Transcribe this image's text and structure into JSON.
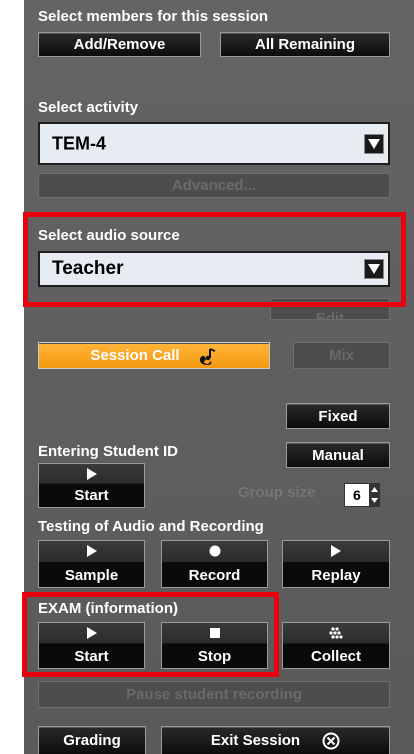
{
  "members": {
    "heading": "Select members for this session",
    "add_remove": "Add/Remove",
    "all_remaining": "All Remaining"
  },
  "activity": {
    "heading": "Select activity",
    "value": "TEM-4",
    "advanced": "Advanced..."
  },
  "audio": {
    "heading": "Select audio source",
    "value": "Teacher",
    "edit": "Edit"
  },
  "session_call": {
    "label": "Session Call",
    "mix": "Mix",
    "accent": "#f7a325"
  },
  "mode": {
    "fixed": "Fixed",
    "manual": "Manual"
  },
  "student_id": {
    "heading": "Entering Student ID",
    "start": "Start",
    "group_size_label": "Group size",
    "group_size_value": "6"
  },
  "testing": {
    "heading": "Testing of Audio and Recording",
    "sample": "Sample",
    "record": "Record",
    "replay": "Replay"
  },
  "exam": {
    "heading": "EXAM  (information)",
    "start": "Start",
    "stop": "Stop",
    "collect": "Collect"
  },
  "pause": "Pause student recording",
  "footer": {
    "grading": "Grading",
    "exit": "Exit Session"
  },
  "highlight_color": "#e8000f"
}
